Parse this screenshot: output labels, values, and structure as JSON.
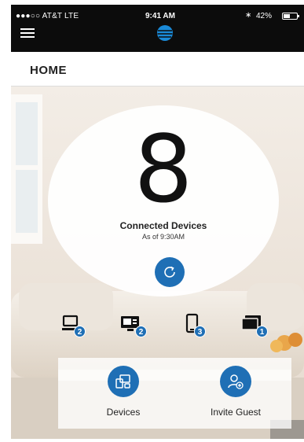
{
  "status_bar": {
    "carrier": "●●●○○ AT&T  LTE",
    "time": "9:41 AM",
    "bluetooth": "∗",
    "battery": "42%"
  },
  "header": {
    "title": "HOME"
  },
  "summary": {
    "count": "8",
    "label": "Connected Devices",
    "as_of": "As of 9:30AM"
  },
  "device_types": [
    {
      "icon": "desktop-icon",
      "count": "2"
    },
    {
      "icon": "tv-icon",
      "count": "2"
    },
    {
      "icon": "phone-icon",
      "count": "3"
    },
    {
      "icon": "tablet-icon",
      "count": "1"
    }
  ],
  "actions": {
    "devices_label": "Devices",
    "invite_label": "Invite Guest"
  },
  "colors": {
    "accent": "#1f6fb5",
    "status_bar": "#0c0c0c"
  }
}
